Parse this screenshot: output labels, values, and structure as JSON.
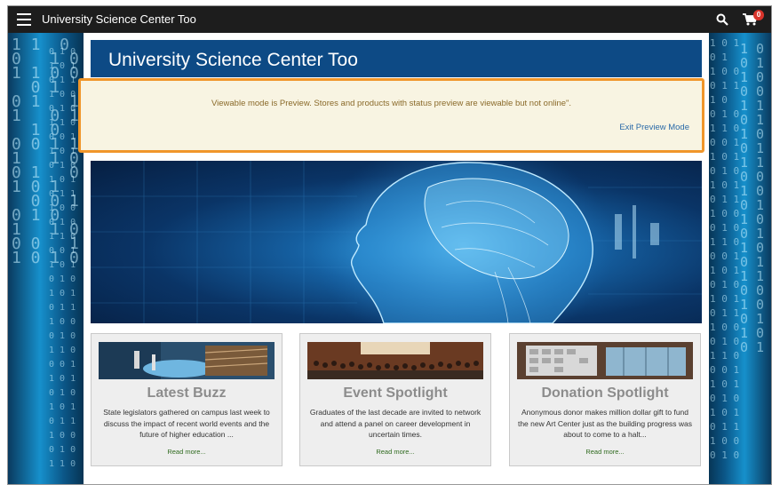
{
  "topbar": {
    "site_name": "University Science Center Too",
    "cart_count": "0"
  },
  "header": {
    "title": "University Science Center Too"
  },
  "notice": {
    "message": "Viewable mode is Preview. Stores and products with status preview are viewable but not online\".",
    "exit_link": "Exit Preview Mode"
  },
  "cards": [
    {
      "title": "Latest Buzz",
      "text": "State legislators gathered on campus last week to discuss the impact of recent world events and the future of higher education ...",
      "read_more": "Read more..."
    },
    {
      "title": "Event Spotlight",
      "text": "Graduates of the last decade are invited to network and attend a panel on career development in uncertain times.",
      "read_more": "Read more..."
    },
    {
      "title": "Donation Spotlight",
      "text": "Anonymous donor makes million dollar gift to fund the new Art Center just as the building progress was about to come to a halt...",
      "read_more": "Read more..."
    }
  ],
  "colors": {
    "topbar": "#1d1d1d",
    "header_banner": "#0d4a85",
    "notice_border": "#f0962a",
    "notice_bg": "#f8f4e2",
    "link": "#2a6aa8",
    "read_more": "#2f6a1f"
  },
  "icons": [
    "menu-icon",
    "search-icon",
    "cart-icon"
  ]
}
